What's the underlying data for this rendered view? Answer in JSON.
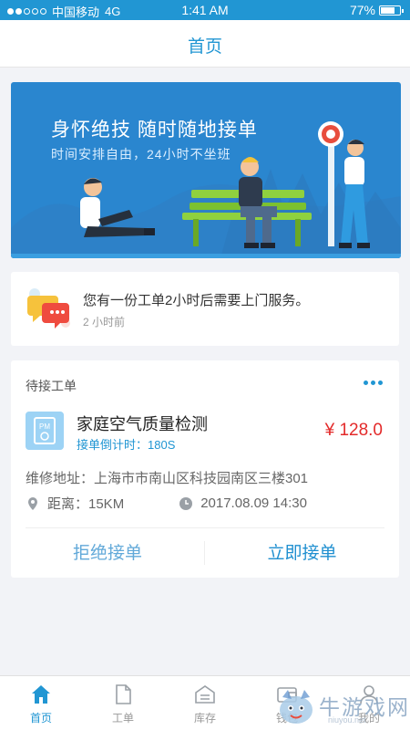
{
  "status_bar": {
    "carrier": "中国移动",
    "network": "4G",
    "time": "1:41 AM",
    "battery": "77%",
    "battery_level": 0.77
  },
  "nav": {
    "title": "首页"
  },
  "banner": {
    "title": "身怀绝技  随时随地接单",
    "subtitle": "时间安排自由，24小时不坐班"
  },
  "message": {
    "icon": "chat-bubbles-icon",
    "text": "您有一份工单2小时后需要上门服务。",
    "time": "2 小时前"
  },
  "order": {
    "header": "待接工单",
    "service_icon": "pm-monitor-icon",
    "service_name": "家庭空气质量检测",
    "countdown": "接单倒计时：180S",
    "price": "¥ 128.0",
    "address": "维修地址：上海市市南山区科技园南区三楼301",
    "distance": "距离：15KM",
    "datetime": "2017.08.09 14:30",
    "reject_label": "拒绝接单",
    "accept_label": "立即接单"
  },
  "tabs": [
    {
      "label": "首页",
      "icon": "home-icon",
      "active": true
    },
    {
      "label": "工单",
      "icon": "document-icon",
      "active": false
    },
    {
      "label": "库存",
      "icon": "warehouse-icon",
      "active": false
    },
    {
      "label": "钱包",
      "icon": "wallet-icon",
      "active": false
    },
    {
      "label": "我的",
      "icon": "user-icon",
      "active": false
    }
  ],
  "watermark": {
    "text": "牛游戏网",
    "url": "niuyou.net"
  },
  "colors": {
    "primary": "#2196d3",
    "banner": "#2a86cf",
    "price": "#e32a2a",
    "background": "#f2f3f7"
  }
}
